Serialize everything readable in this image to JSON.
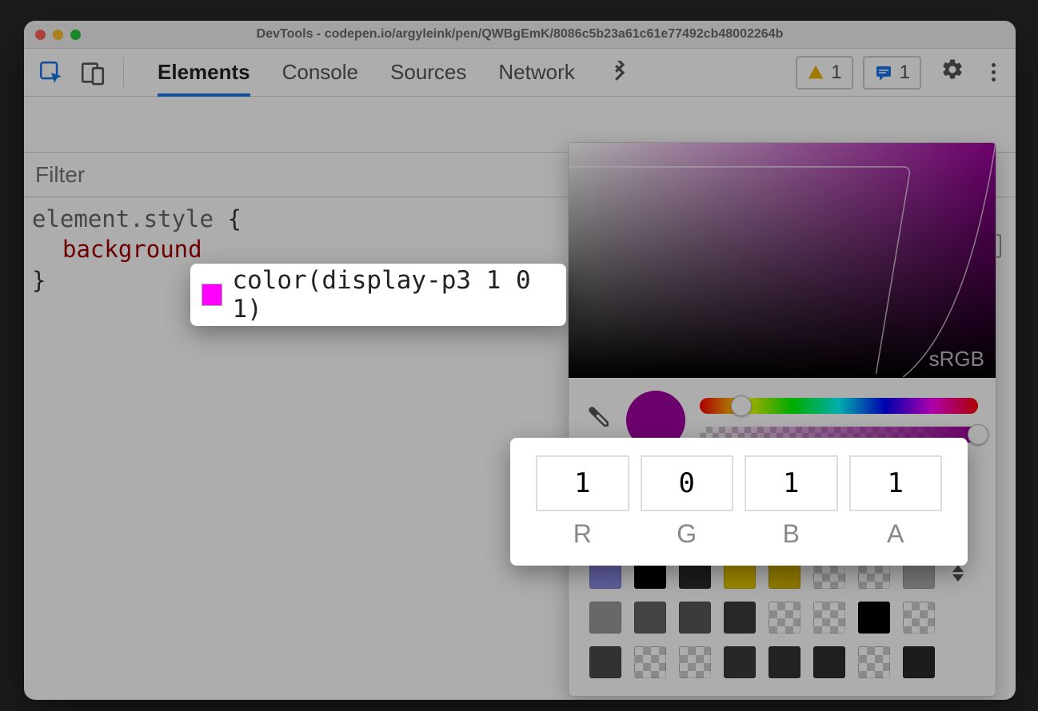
{
  "window": {
    "title": "DevTools - codepen.io/argyleink/pen/QWBgEmK/8086c5b23a61c61e77492cb48002264b"
  },
  "toolbar": {
    "tabs": [
      "Elements",
      "Console",
      "Sources",
      "Network"
    ],
    "active_tab": 0,
    "warnings_count": "1",
    "messages_count": "1"
  },
  "styles": {
    "filter_placeholder": "Filter",
    "selector": "element.style",
    "open_brace": "{",
    "property_name": "background",
    "property_value": "color(display-p3 1 0 1)",
    "close_brace": "}"
  },
  "color_picker": {
    "gamut_label": "sRGB",
    "hue_thumb_pct": 15,
    "alpha_thumb_pct": 100,
    "channels": {
      "r": {
        "label": "R",
        "value": "1"
      },
      "g": {
        "label": "G",
        "value": "0"
      },
      "b": {
        "label": "B",
        "value": "1"
      },
      "a": {
        "label": "A",
        "value": "1"
      }
    },
    "swatch_color": "#a000a0",
    "palette": [
      "#8b8be6",
      "#000000",
      "#2a2a2a",
      "#e6c800",
      "#d4b400",
      "check",
      "check",
      "#b0b0b0",
      "#9a9a9a",
      "#636363",
      "#585858",
      "#3c3c3c",
      "check",
      "check",
      "#000000",
      "check",
      "#4a4a4a",
      "check",
      "check",
      "#3a3a3a",
      "#333333",
      "#2e2e2e",
      "check",
      "#2a2a2a"
    ]
  }
}
